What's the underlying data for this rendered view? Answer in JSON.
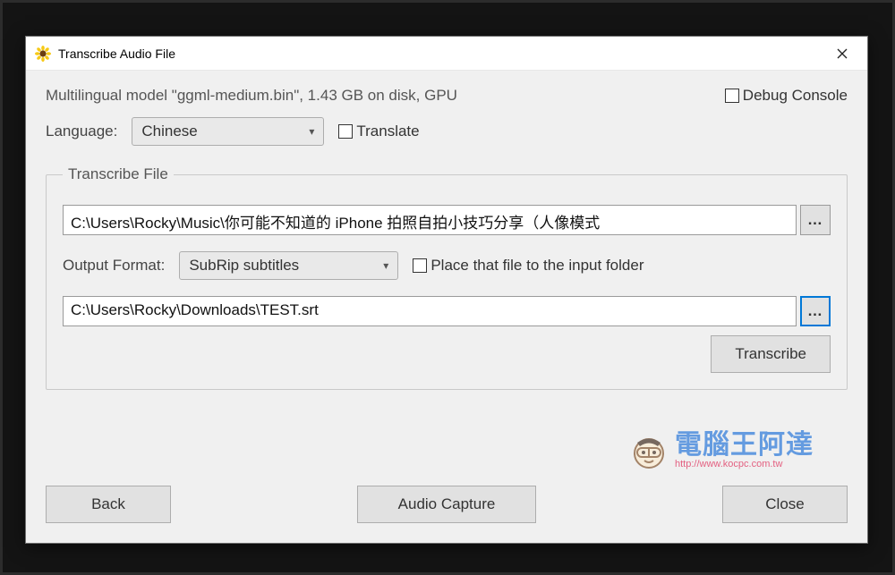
{
  "window": {
    "title": "Transcribe Audio File"
  },
  "model_info": "Multilingual model \"ggml-medium.bin\", 1.43 GB on disk, GPU",
  "debug_console_label": "Debug Console",
  "language_label": "Language:",
  "language_value": "Chinese",
  "translate_label": "Translate",
  "group_legend": "Transcribe File",
  "input_path": "C:\\Users\\Rocky\\Music\\你可能不知道的 iPhone 拍照自拍小技巧分享（人像模式",
  "output_format_label": "Output Format:",
  "output_format_value": "SubRip subtitles",
  "place_in_folder_label": "Place that file to the input folder",
  "output_path": "C:\\Users\\Rocky\\Downloads\\TEST.srt",
  "browse_label": "…",
  "transcribe_btn": "Transcribe",
  "back_btn": "Back",
  "audio_capture_btn": "Audio Capture",
  "close_btn": "Close",
  "watermark": {
    "title": "電腦王阿達",
    "url": "http://www.kocpc.com.tw"
  }
}
